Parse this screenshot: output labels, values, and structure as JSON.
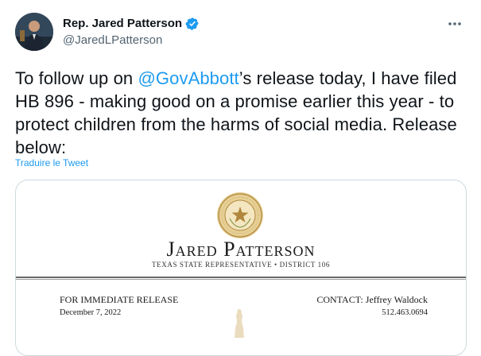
{
  "author": {
    "display_name": "Rep. Jared Patterson",
    "handle": "@JaredLPatterson",
    "verified": true
  },
  "tweet": {
    "text_before": "To follow up on ",
    "mention": "@GovAbbott",
    "text_after": "’s release today, I have filed HB 896 - making good on a promise earlier this year - to protect children from the harms of social media. Release below:",
    "translate_label": "Traduire le Tweet"
  },
  "media": {
    "letterhead_name": "Jared Patterson",
    "letterhead_title": "TEXAS STATE REPRESENTATIVE • DISTRICT 106",
    "release_label": "FOR IMMEDIATE RELEASE",
    "release_date": "December 7, 2022",
    "contact_label": "CONTACT: Jeffrey Waldock",
    "contact_phone": "512.463.0694"
  },
  "colors": {
    "accent": "#1d9bf0",
    "text": "#0f1419",
    "muted": "#536471",
    "border": "#cfd9de",
    "seal_gold": "#c9a45a"
  },
  "icons": {
    "verified": "verified-badge-icon",
    "more": "more-options-icon",
    "seal": "state-seal-icon"
  }
}
